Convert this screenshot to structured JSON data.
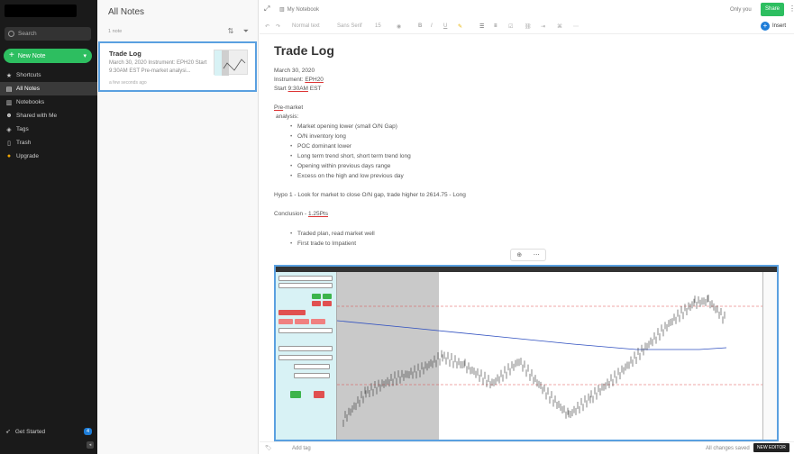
{
  "sidebar": {
    "search_placeholder": "Search",
    "new_note_label": "New Note",
    "items": [
      {
        "label": "Shortcuts",
        "icon": "star-icon",
        "active": false
      },
      {
        "label": "All Notes",
        "icon": "notes-icon",
        "active": true
      },
      {
        "label": "Notebooks",
        "icon": "notebook-icon",
        "active": false
      },
      {
        "label": "Shared with Me",
        "icon": "shared-icon",
        "active": false
      },
      {
        "label": "Tags",
        "icon": "tag-icon",
        "active": false
      },
      {
        "label": "Trash",
        "icon": "trash-icon",
        "active": false
      },
      {
        "label": "Upgrade",
        "icon": "upgrade-icon",
        "active": false
      }
    ],
    "get_started_label": "Get Started",
    "get_started_badge": "4"
  },
  "note_list": {
    "title": "All Notes",
    "count": "1 note",
    "note": {
      "title": "Trade Log",
      "snippet": "March 30, 2020 Instrument: EPH20 Start 9:30AM EST Pre-market analysi...",
      "date": "a few seconds ago"
    }
  },
  "editor": {
    "notebook": "My Notebook",
    "only_you": "Only you",
    "share_label": "Share",
    "insert_label": "Insert",
    "toolbar": {
      "style": "Normal text",
      "font": "Sans Serif",
      "size": "15"
    },
    "title": "Trade Log",
    "date_line": "March 30, 2020",
    "instrument_label": "Instrument: ",
    "instrument": "EPH20",
    "start_label": "Start ",
    "start_time": "9:30AM",
    "start_tz": " EST",
    "pre_1": "Pre",
    "pre_2": "-market",
    "analysis": " analysis:",
    "bullets1": [
      "Market opening lower (small O/N Gap)",
      "O/N inventory long",
      "POC dominant lower",
      "Long term trend short, short term trend long",
      "Opening within previous days range",
      "Excess on the high and low previous day"
    ],
    "hypo": "Hypo 1 - Look for market to close O/N gap, trade higher to 2614.75 - Long",
    "conclusion_label": "Conclusion - ",
    "conclusion_value": "1.25Pts",
    "bullets2": [
      "Traded plan, read market well",
      "First trade to Impatient"
    ]
  },
  "footer": {
    "add_tag": "Add tag",
    "saved": "All changes saved",
    "new_editor": "NEW EDITOR"
  },
  "colors": {
    "accent_green": "#2dbe60",
    "selection_blue": "#5aa0e0",
    "sidebar_bg": "#1a1a1a"
  }
}
